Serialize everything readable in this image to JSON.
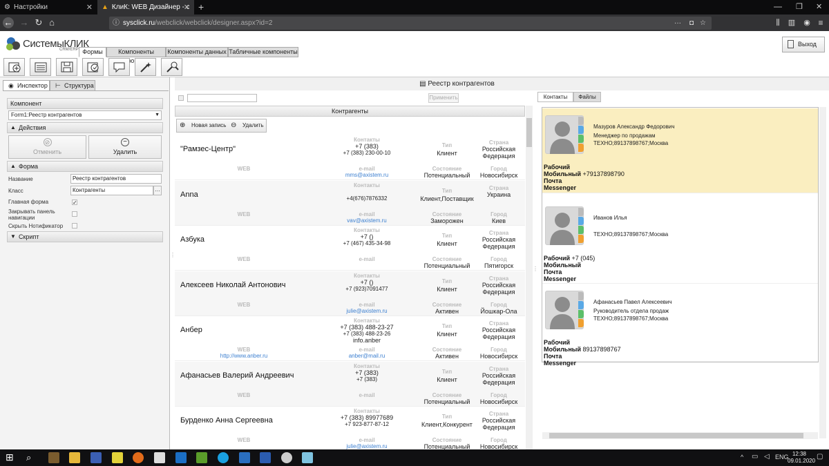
{
  "browser": {
    "tabs": [
      {
        "title": "Настройки"
      },
      {
        "title": "КлиК: WEB Дизайнер - сервер"
      }
    ],
    "url_host": "sysclick.ru",
    "url_path": "/webclick/webclick/designer.aspx?id=2"
  },
  "app": {
    "logo_text": "СистемыКЛИК",
    "logo_sub": "CRM/ERP",
    "tabs": [
      "Формы",
      "Компоненты формы",
      "Компоненты данных",
      "Табличные компоненты"
    ],
    "exit_label": "Выход"
  },
  "inspector": {
    "tabs": [
      "Инспектор",
      "Структура"
    ],
    "component_header": "Компонент",
    "component_value": "Form1:Реестр контрагентов",
    "actions_header": "Действия",
    "cancel_label": "Отменить",
    "delete_label": "Удалить",
    "form_header": "Форма",
    "fields": [
      {
        "label": "Название",
        "value": "Реестр контрагентов"
      },
      {
        "label": "Класс",
        "value": "Контрагенты"
      }
    ],
    "checks": [
      {
        "label": "Главная форма",
        "checked": true
      },
      {
        "label": "Закрывать панель навигации",
        "checked": false
      },
      {
        "label": "Скрыть Нотификатор",
        "checked": false
      }
    ],
    "script_header": "Скрипт"
  },
  "form": {
    "title": "Реестр контрагентов",
    "apply_label": "Применить",
    "list_header": "Контрагенты",
    "new_label": "Новая запись",
    "delete_label": "Удалить",
    "col_labels": {
      "contacts": "Контакты",
      "type": "Тип",
      "country": "Страна",
      "web": "WEB",
      "email": "e-mail",
      "state": "Состояние",
      "city": "Город"
    },
    "rows": [
      {
        "name": "\"Рамзес-Центр\"",
        "phone1": "+7 (383)",
        "phone2": "+7 (383) 230-00-10",
        "phone3": "",
        "type": "Клиент",
        "country": "Российская Федерация",
        "web": "",
        "email": "mms@axistem.ru",
        "state": "Потенциальный",
        "city": "Новосибирск"
      },
      {
        "name": "Anna",
        "phone1": "",
        "phone2": "+4(676)7876332",
        "phone3": "",
        "type": "Клиент,Поставщик",
        "country": "Украина",
        "web": "",
        "email": "vav@axistem.ru",
        "state": "Заморожен",
        "city": "Киев"
      },
      {
        "name": "Азбука",
        "phone1": "+7 ()",
        "phone2": "+7 (467) 435-34-98",
        "phone3": "",
        "type": "Клиент",
        "country": "Российская Федерация",
        "web": "",
        "email": "",
        "state": "Потенциальный",
        "city": "Пятигорск"
      },
      {
        "name": "Алексеев Николай Антонович",
        "phone1": "+7 ()",
        "phone2": "+7 (923)7091477",
        "phone3": "",
        "type": "Клиент",
        "country": "Российская Федерация",
        "web": "",
        "email": "julie@axistem.ru",
        "state": "Активен",
        "city": "Йошкар-Ола"
      },
      {
        "name": "Анбер",
        "phone1": "+7 (383) 488-23-27",
        "phone2": "+7 (383) 488-23-26",
        "phone3": "info.anber",
        "type": "Клиент",
        "country": "Российская Федерация",
        "web": "http://www.anber.ru",
        "email": "anber@mail.ru",
        "state": "Активен",
        "city": "Новосибирск"
      },
      {
        "name": "Афанасьев Валерий Андреевич",
        "phone1": "+7 (383)",
        "phone2": "+7 (383)",
        "phone3": "",
        "type": "Клиент",
        "country": "Российская Федерация",
        "web": "",
        "email": "",
        "state": "Потенциальный",
        "city": "Новосибирск"
      },
      {
        "name": "Бурденко Анна Сергеевна",
        "phone1": "+7 (383) 89977689",
        "phone2": "+7 923-877-87-12",
        "phone3": "",
        "type": "Клиент,Конкурент",
        "country": "Российская Федерация",
        "web": "",
        "email": "julie@axistem.ru",
        "state": "Потенциальный",
        "city": "Новосибирск"
      }
    ]
  },
  "contacts": {
    "tabs": [
      "Контакты",
      "Файлы"
    ],
    "phone_labels": {
      "work": "Рабочий",
      "mobile": "Мобильный",
      "mail": "Почта",
      "messenger": "Messenger"
    },
    "cards": [
      {
        "name": "Мазуров Александр Федорович",
        "position": "Менеджер по продажам",
        "org": "ТЕХНО;89137898767;Москва",
        "work": "",
        "mobile": "+79137898790",
        "highlight": true
      },
      {
        "name": "Иванов Илья",
        "position": "",
        "org": "ТЕХНО;89137898767;Москва",
        "work": "+7 (045)",
        "mobile": "",
        "highlight": false
      },
      {
        "name": "Афанасьев Павел Алексеевич",
        "position": "Руководитель отдела продаж",
        "org": "ТЕХНО;89137898767;Москва",
        "work": "",
        "mobile": "89137898767",
        "highlight": false
      }
    ]
  },
  "system": {
    "lang": "ENG",
    "time": "12:38",
    "date": "09.01.2020"
  }
}
